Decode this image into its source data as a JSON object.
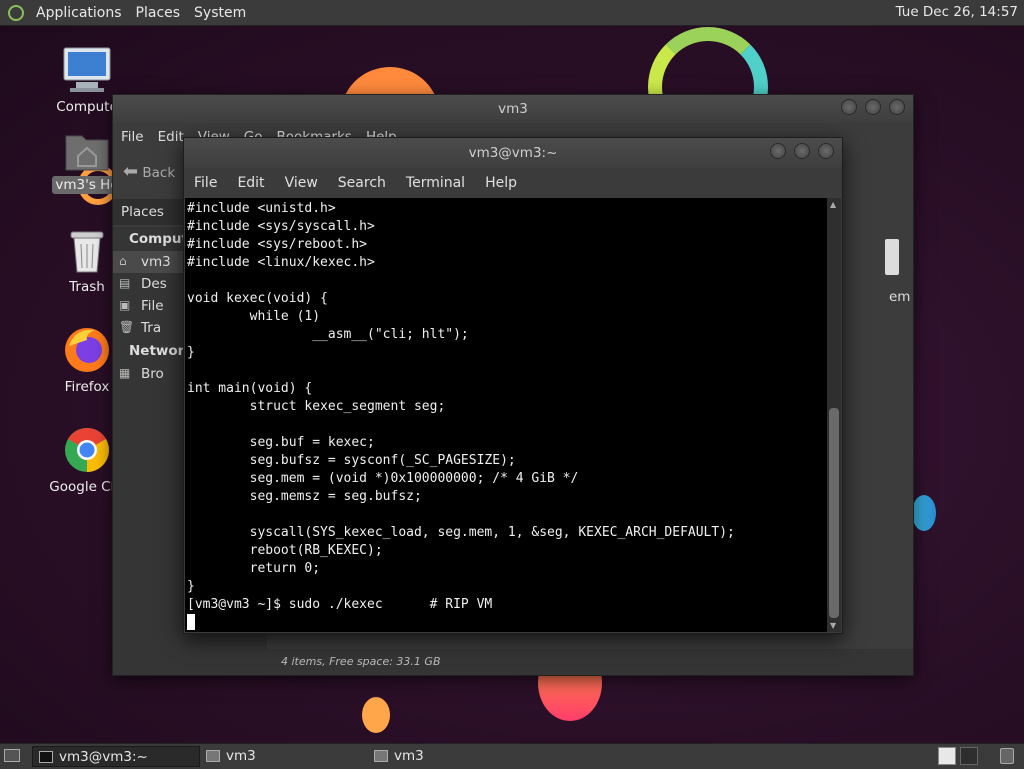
{
  "top_panel": {
    "menus": [
      "Applications",
      "Places",
      "System"
    ],
    "clock": "Tue Dec 26, 14:57"
  },
  "desktop_icons": [
    {
      "name": "computer-icon",
      "label": "Compute"
    },
    {
      "name": "home-folder-icon",
      "label": "vm3's Ho"
    },
    {
      "name": "trash-icon",
      "label": "Trash"
    },
    {
      "name": "firefox-icon",
      "label": "Firefox"
    },
    {
      "name": "chrome-icon",
      "label": "Google Chr"
    }
  ],
  "file_manager": {
    "title": "vm3",
    "menus": [
      "File",
      "Edit",
      "View",
      "Go",
      "Bookmarks",
      "Help"
    ],
    "back_label": "Back",
    "sidebar_header": "Places",
    "sidebar": {
      "computer_header": "Compute",
      "items": [
        "vm3",
        "Des",
        "File",
        "Tra"
      ],
      "network_header": "Network",
      "network_items": [
        "Bro"
      ]
    },
    "right_item_label": "em",
    "status": "4 items, Free space: 33.1 GB"
  },
  "terminal": {
    "title": "vm3@vm3:~",
    "menus": [
      "File",
      "Edit",
      "View",
      "Search",
      "Terminal",
      "Help"
    ],
    "lines": [
      "#include <unistd.h>",
      "#include <sys/syscall.h>",
      "#include <sys/reboot.h>",
      "#include <linux/kexec.h>",
      "",
      "void kexec(void) {",
      "        while (1)",
      "                __asm__(\"cli; hlt\");",
      "}",
      "",
      "int main(void) {",
      "        struct kexec_segment seg;",
      "",
      "        seg.buf = kexec;",
      "        seg.bufsz = sysconf(_SC_PAGESIZE);",
      "        seg.mem = (void *)0x100000000; /* 4 GiB */",
      "        seg.memsz = seg.bufsz;",
      "",
      "        syscall(SYS_kexec_load, seg.mem, 1, &seg, KEXEC_ARCH_DEFAULT);",
      "        reboot(RB_KEXEC);",
      "        return 0;",
      "}",
      "[vm3@vm3 ~]$ sudo ./kexec      # RIP VM"
    ]
  },
  "taskbar": {
    "tasks": [
      "vm3@vm3:~",
      "vm3",
      "vm3"
    ]
  },
  "colors": {
    "panel": "#3b3b3b",
    "desktop": "#2b1126",
    "terminal_bg": "#000000"
  }
}
